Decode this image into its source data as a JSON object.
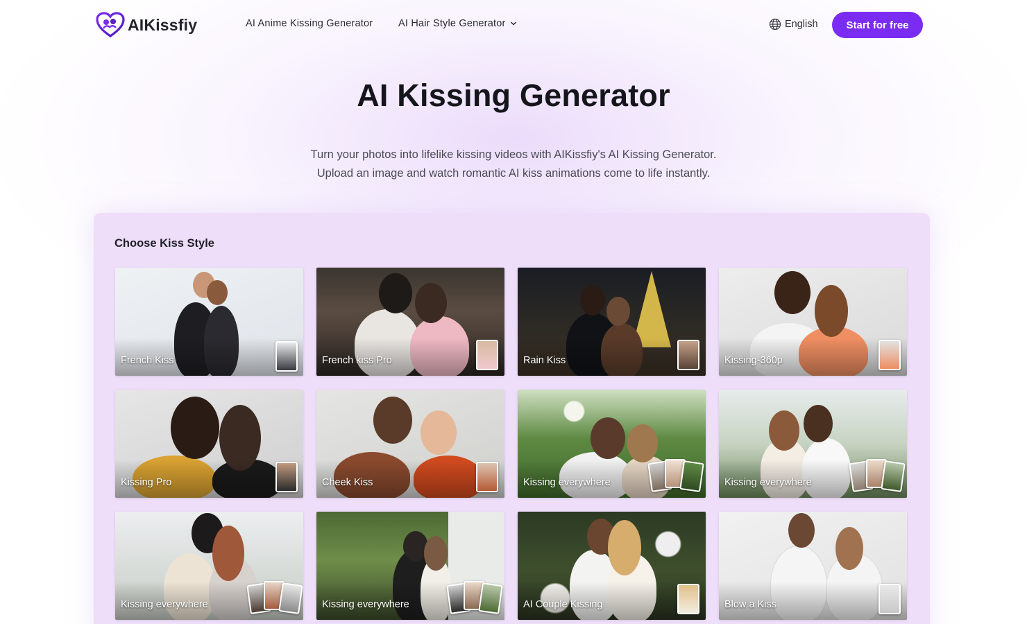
{
  "brand": {
    "name": "AIKissfiy"
  },
  "nav": {
    "links": [
      "AI Anime Kissing Generator",
      "AI Hair Style Generator"
    ],
    "language": "English",
    "cta": "Start for free"
  },
  "hero": {
    "title": "AI Kissing Generator",
    "desc_line1": "Turn your photos into lifelike kissing videos with  AIKissfiy's AI Kissing Generator.",
    "desc_line2": "Upload an image and watch romantic AI kiss animations come to life instantly."
  },
  "styles": {
    "title": "Choose Kiss Style",
    "cards": [
      "French Kiss",
      "French kiss Pro",
      "Rain Kiss",
      "Kissing-360p",
      "Kissing Pro",
      "Cheek Kiss",
      "Kissing everywhere",
      "Kissing everywhere",
      "Kissing everywhere",
      "Kissing everywhere",
      "AI Couple Kissing",
      "Blow a Kiss"
    ]
  },
  "colors": {
    "accent": "#7b2cf2",
    "panel": "#eedef9"
  }
}
